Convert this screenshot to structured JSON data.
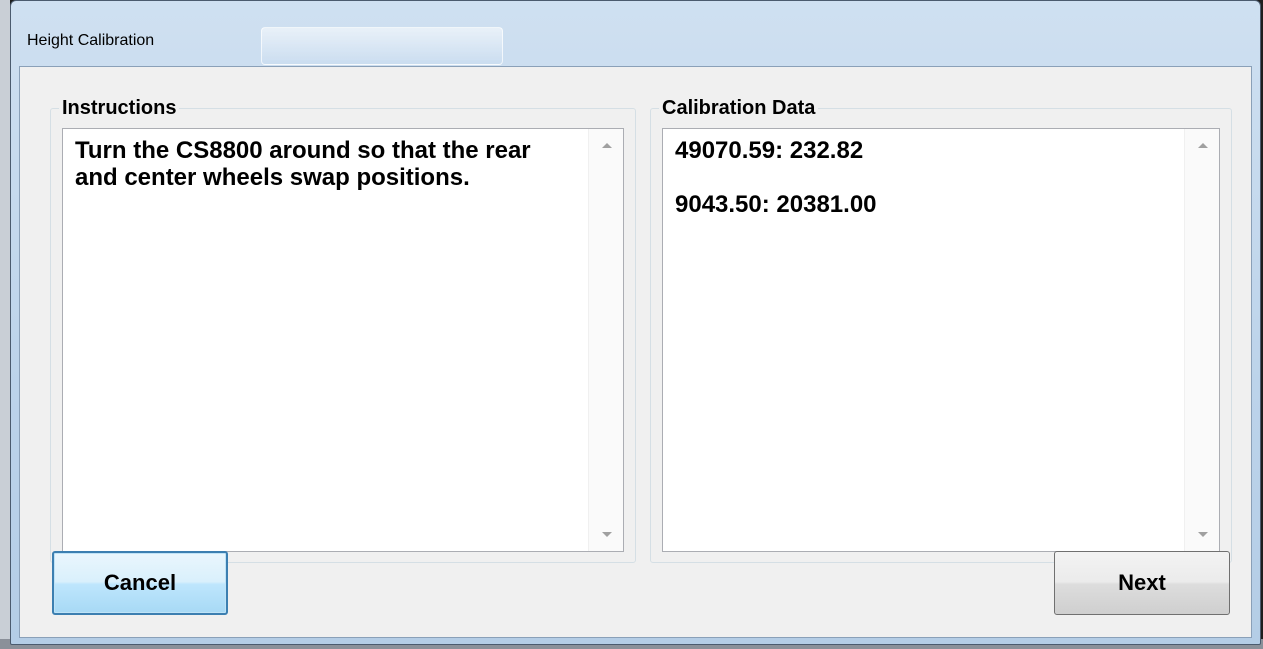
{
  "window": {
    "title": "Height Calibration"
  },
  "instructions": {
    "label": "Instructions",
    "text": "Turn the CS8800 around so that the rear and center wheels swap positions."
  },
  "calibration": {
    "label": "Calibration Data",
    "lines": [
      "49070.59:  232.82",
      "9043.50:  20381.00"
    ]
  },
  "buttons": {
    "cancel_label": "Cancel",
    "next_label": "Next"
  }
}
